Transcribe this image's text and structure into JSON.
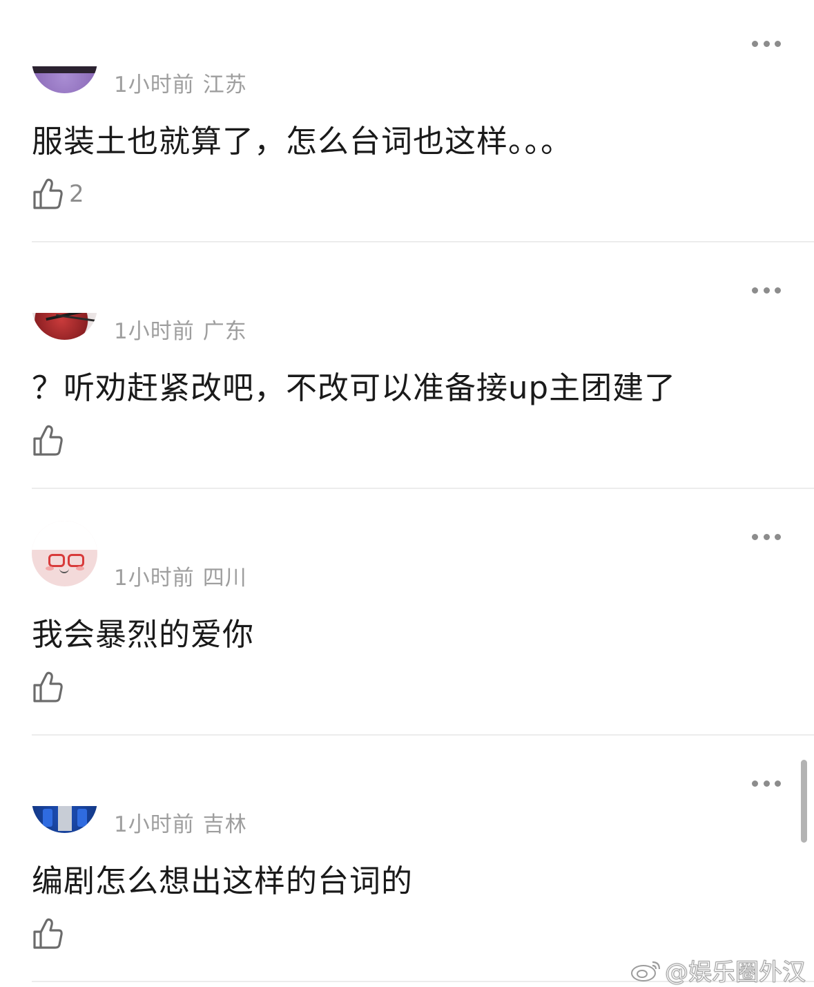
{
  "comments": [
    {
      "time": "1小时前",
      "location": "江苏",
      "text": "服装土也就算了，怎么台词也这样。。。",
      "likes": "2"
    },
    {
      "time": "1小时前",
      "location": "广东",
      "text": "？听劝赶紧改吧，不改可以准备接up主团建了",
      "likes": ""
    },
    {
      "time": "1小时前",
      "location": "四川",
      "text": "我会暴烈的爱你",
      "likes": ""
    },
    {
      "time": "1小时前",
      "location": "吉林",
      "text": "编剧怎么想出这样的台词的",
      "likes": ""
    }
  ],
  "watermark": {
    "text": "@娱乐圈外汉",
    "icon": "weibo-icon"
  },
  "icons": {
    "more": "more-icon",
    "like": "thumbs-up-icon"
  },
  "colors": {
    "background": "#ffffff",
    "text": "#1a1a1a",
    "meta": "#9e9e9e",
    "divider": "#ececec"
  }
}
